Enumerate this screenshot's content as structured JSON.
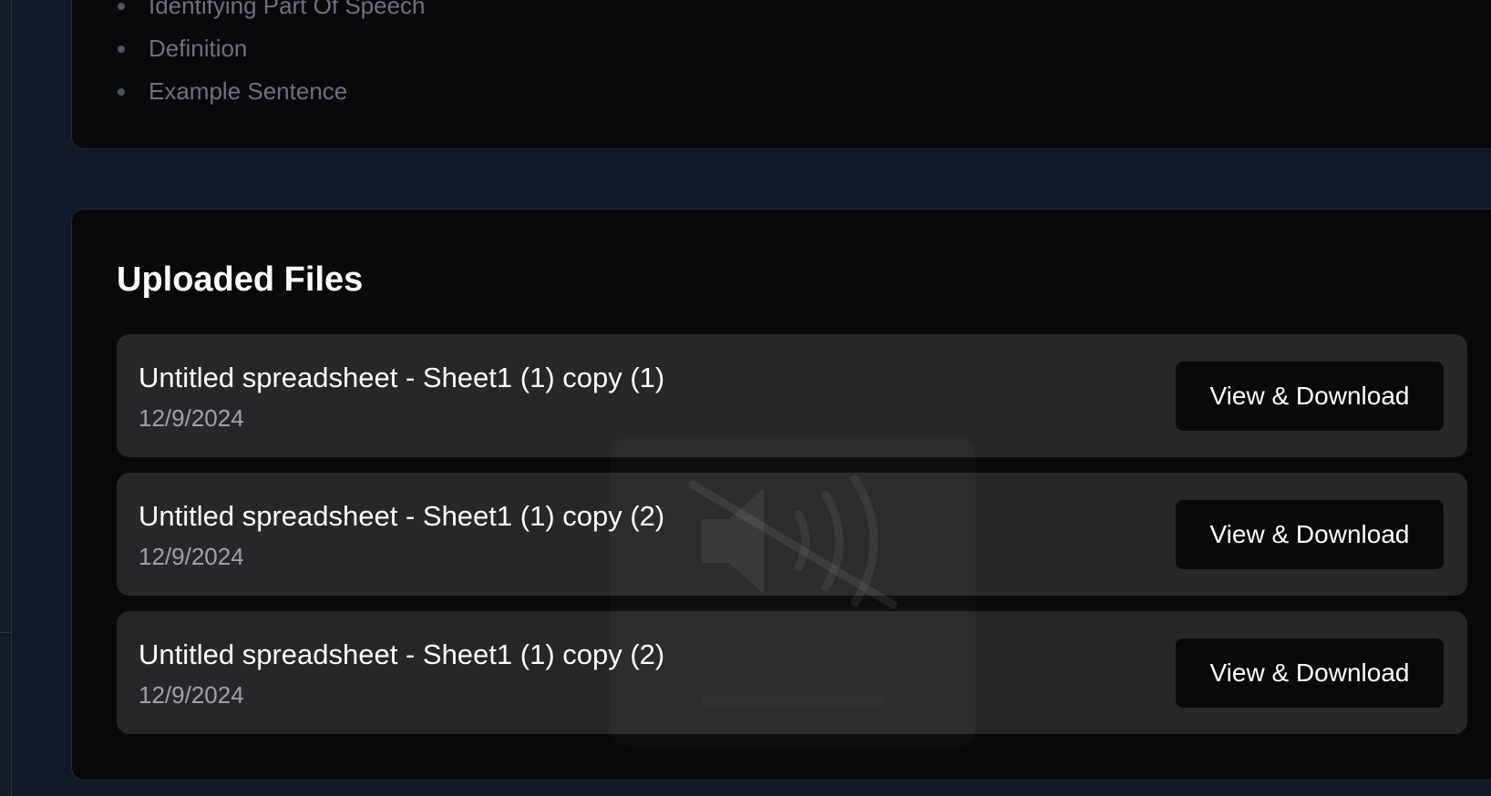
{
  "definitions_card": {
    "items": [
      "Identifying Part Of Speech",
      "Definition",
      "Example Sentence"
    ]
  },
  "uploaded_files": {
    "title": "Uploaded Files",
    "files": [
      {
        "name": "Untitled spreadsheet - Sheet1 (1) copy (1)",
        "date": "12/9/2024",
        "button_label": "View & Download"
      },
      {
        "name": "Untitled spreadsheet - Sheet1 (1) copy (2)",
        "date": "12/9/2024",
        "button_label": "View & Download"
      },
      {
        "name": "Untitled spreadsheet - Sheet1 (1) copy (2)",
        "date": "12/9/2024",
        "button_label": "View & Download"
      }
    ]
  },
  "overlay": {
    "icon": "volume-muted-icon"
  },
  "colors": {
    "page_background": "#111827",
    "card_background": "#09090b",
    "file_row_background": "#27272a",
    "button_background": "#09090b",
    "muted_text": "#6b7280",
    "date_text": "#9ca3af"
  }
}
